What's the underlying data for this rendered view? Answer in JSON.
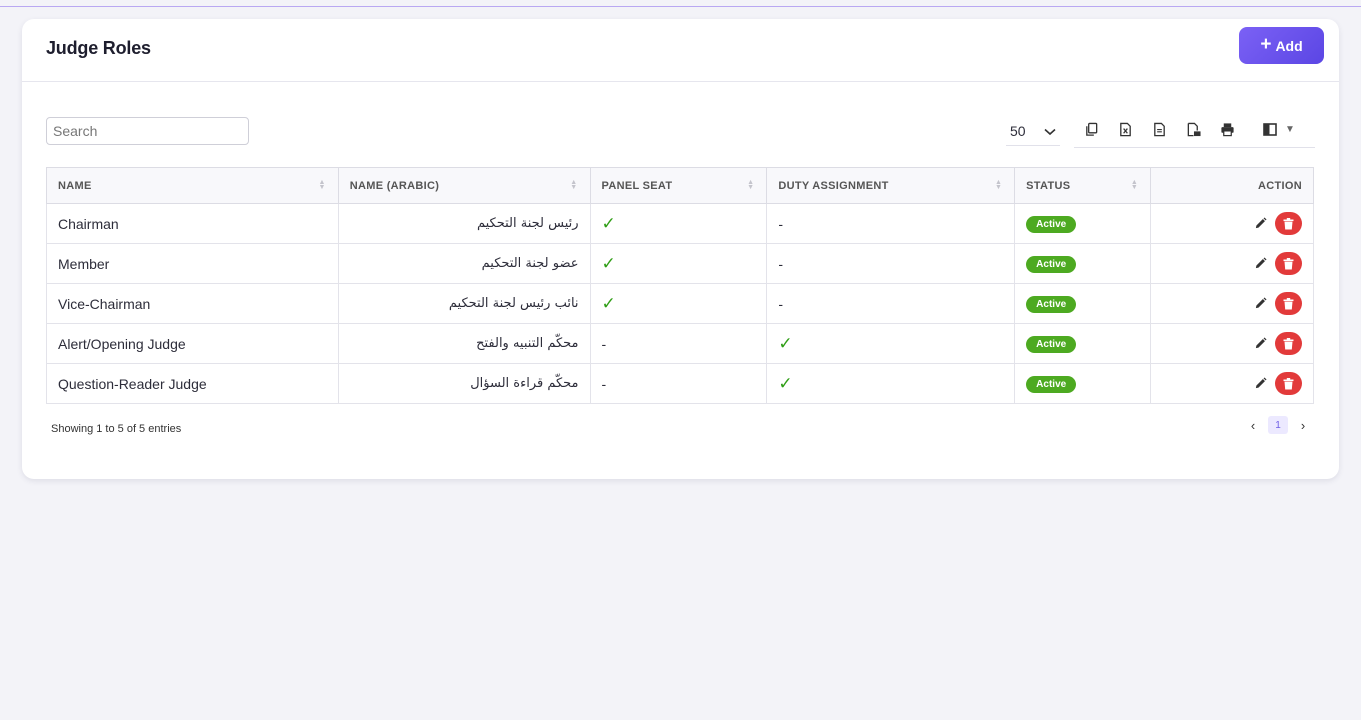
{
  "header": {
    "title": "Judge Roles",
    "add_label": "Add"
  },
  "search": {
    "placeholder": "Search",
    "value": ""
  },
  "page_size": "50",
  "toolbar": {
    "icons": [
      "copy-icon",
      "excel-icon",
      "csv-icon",
      "pdf-icon",
      "print-icon",
      "columns-icon"
    ]
  },
  "table": {
    "columns": [
      "NAME",
      "NAME (ARABIC)",
      "PANEL SEAT",
      "DUTY ASSIGNMENT",
      "STATUS",
      "ACTION"
    ],
    "rows": [
      {
        "name": "Chairman",
        "name_ar": "رئيس لجنة التحكيم",
        "panel_seat": "✓",
        "duty": "-",
        "status": "Active"
      },
      {
        "name": "Member",
        "name_ar": "عضو لجنة التحكيم",
        "panel_seat": "✓",
        "duty": "-",
        "status": "Active"
      },
      {
        "name": "Vice-Chairman",
        "name_ar": "نائب رئيس لجنة التحكيم",
        "panel_seat": "✓",
        "duty": "-",
        "status": "Active"
      },
      {
        "name": "Alert/Opening Judge",
        "name_ar": "محكّم التنبيه والفتح",
        "panel_seat": "-",
        "duty": "✓",
        "status": "Active"
      },
      {
        "name": "Question-Reader Judge",
        "name_ar": "محكّم قراءة السؤال",
        "panel_seat": "-",
        "duty": "✓",
        "status": "Active"
      }
    ]
  },
  "footer": {
    "info": "Showing 1 to 5 of 5 entries",
    "current_page": "1",
    "prev": "‹",
    "next": "›"
  },
  "colors": {
    "accent": "#6a54ee",
    "active_badge": "#4daa21",
    "check": "#2f9e16",
    "delete": "#e23a3a"
  }
}
